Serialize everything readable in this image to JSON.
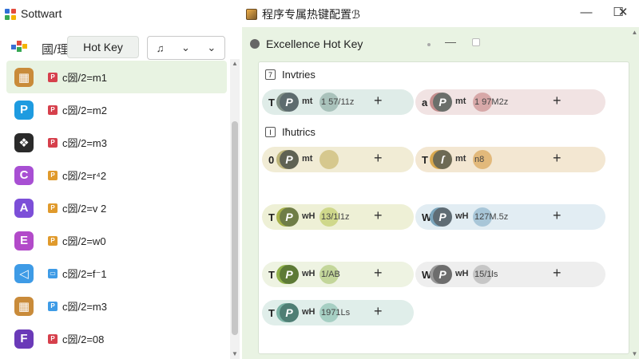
{
  "window": {
    "app_title": "Sottwart",
    "center_title": "程序专属热键配置ℬ",
    "minimize": "—",
    "maximize": "☐",
    "close": "✕",
    "logo_colors": [
      "#2f6fd6",
      "#e44b3c",
      "#36a853",
      "#f4b400"
    ]
  },
  "left": {
    "header_label": "國/理",
    "hotkey_tab": "Hot Key",
    "dropdown_bell": "♫",
    "dropdown_chevron": "⌄",
    "dropdown_chevron2": "⌄",
    "items": [
      {
        "label": "c圀/2=m1",
        "icon_glyph": "▦",
        "icon_color": "#c98b3a",
        "badge_color": "#d6404c",
        "badge_glyph": "P",
        "selected": true
      },
      {
        "label": "c圀/2=m2",
        "icon_glyph": "P",
        "icon_color": "#1e9be0",
        "badge_color": "#d6404c",
        "badge_glyph": "P",
        "selected": false
      },
      {
        "label": "c圀/2=m3",
        "icon_glyph": "❖",
        "icon_color": "#2a2a2a",
        "badge_color": "#d6404c",
        "badge_glyph": "P",
        "selected": false
      },
      {
        "label": "c圀/2=r⁴2",
        "icon_glyph": "C",
        "icon_color": "#a84fd3",
        "badge_color": "#e09a2c",
        "badge_glyph": "P",
        "selected": false
      },
      {
        "label": "c圀/2=v 2",
        "icon_glyph": "A",
        "icon_color": "#7c4fd8",
        "badge_color": "#e09a2c",
        "badge_glyph": "P",
        "selected": false
      },
      {
        "label": "c圀/2=w0",
        "icon_glyph": "E",
        "icon_color": "#b24ac9",
        "badge_color": "#e09a2c",
        "badge_glyph": "P",
        "selected": false
      },
      {
        "label": "c圀/2=f⁻1",
        "icon_glyph": "◁",
        "icon_color": "#3e9be6",
        "badge_color": "#3e9be6",
        "badge_glyph": "▭",
        "selected": false
      },
      {
        "label": "c圀/2=m3",
        "icon_glyph": "▦",
        "icon_color": "#c98b3a",
        "badge_color": "#3e9be6",
        "badge_glyph": "P",
        "selected": false
      },
      {
        "label": "c圀/2=08",
        "icon_glyph": "F",
        "icon_color": "#6a3ab8",
        "badge_color": "#d6404c",
        "badge_glyph": "P",
        "selected": false
      }
    ]
  },
  "right": {
    "title": "Excellence Hot Key",
    "minimize": "—",
    "section1": "Invtries",
    "section1_icon": "7",
    "section2": "Iħutrics",
    "section2_icon": "I",
    "chips": [
      {
        "key": "T",
        "mod": "mt",
        "combo": "1 57/11z",
        "glyph": "P",
        "bg": "#dfece8",
        "c1": "#7f8f86",
        "c2": "#5d6b6e",
        "c3": "#a9c2bb"
      },
      {
        "key": "a",
        "mod": "mt",
        "combo": "1 97M2z",
        "glyph": "P",
        "bg": "#f1e3e3",
        "c1": "#c58e8e",
        "c2": "#6b6f6b",
        "c3": "#d7a8a8"
      },
      {
        "key": "0",
        "mod": "mt",
        "combo": "",
        "glyph": "P",
        "bg": "#f1ecd5",
        "c1": "#bdb57a",
        "c2": "#5f6253",
        "c3": "#d6c88e"
      },
      {
        "key": "T",
        "mod": "mt",
        "combo": "n8",
        "glyph": "ſ",
        "bg": "#f3e7d2",
        "c1": "#d9a94f",
        "c2": "#6d6a54",
        "c3": "#e2b97b"
      },
      {
        "key": "T",
        "mod": "wH",
        "combo": "13/1l1z",
        "glyph": "P",
        "bg": "#eef0d6",
        "c1": "#a8b24a",
        "c2": "#6f7d47",
        "c3": "#cfd88b"
      },
      {
        "key": "W",
        "mod": "wH",
        "combo": "127M.5z",
        "glyph": "P",
        "bg": "#e2edf3",
        "c1": "#7aa5bc",
        "c2": "#5f6c74",
        "c3": "#a8c6d8"
      },
      {
        "key": "T",
        "mod": "wH",
        "combo": "1/AB",
        "glyph": "P",
        "bg": "#eef3e2",
        "c1": "#8fb04a",
        "c2": "#5d7a36",
        "c3": "#c3d69a"
      },
      {
        "key": "W",
        "mod": "wH",
        "combo": "15/1ls",
        "glyph": "P",
        "bg": "#eeeeee",
        "c1": "#9a9a9a",
        "c2": "#6d6d6d",
        "c3": "#c6c6c6"
      },
      {
        "key": "T",
        "mod": "wH",
        "combo": "1971Ls",
        "glyph": "P",
        "bg": "#e0eeea",
        "c1": "#7ab2a4",
        "c2": "#4f7e74",
        "c3": "#a6cfc3"
      }
    ],
    "plus": "+"
  },
  "scroll": {
    "up": "▲",
    "down": "▼"
  }
}
